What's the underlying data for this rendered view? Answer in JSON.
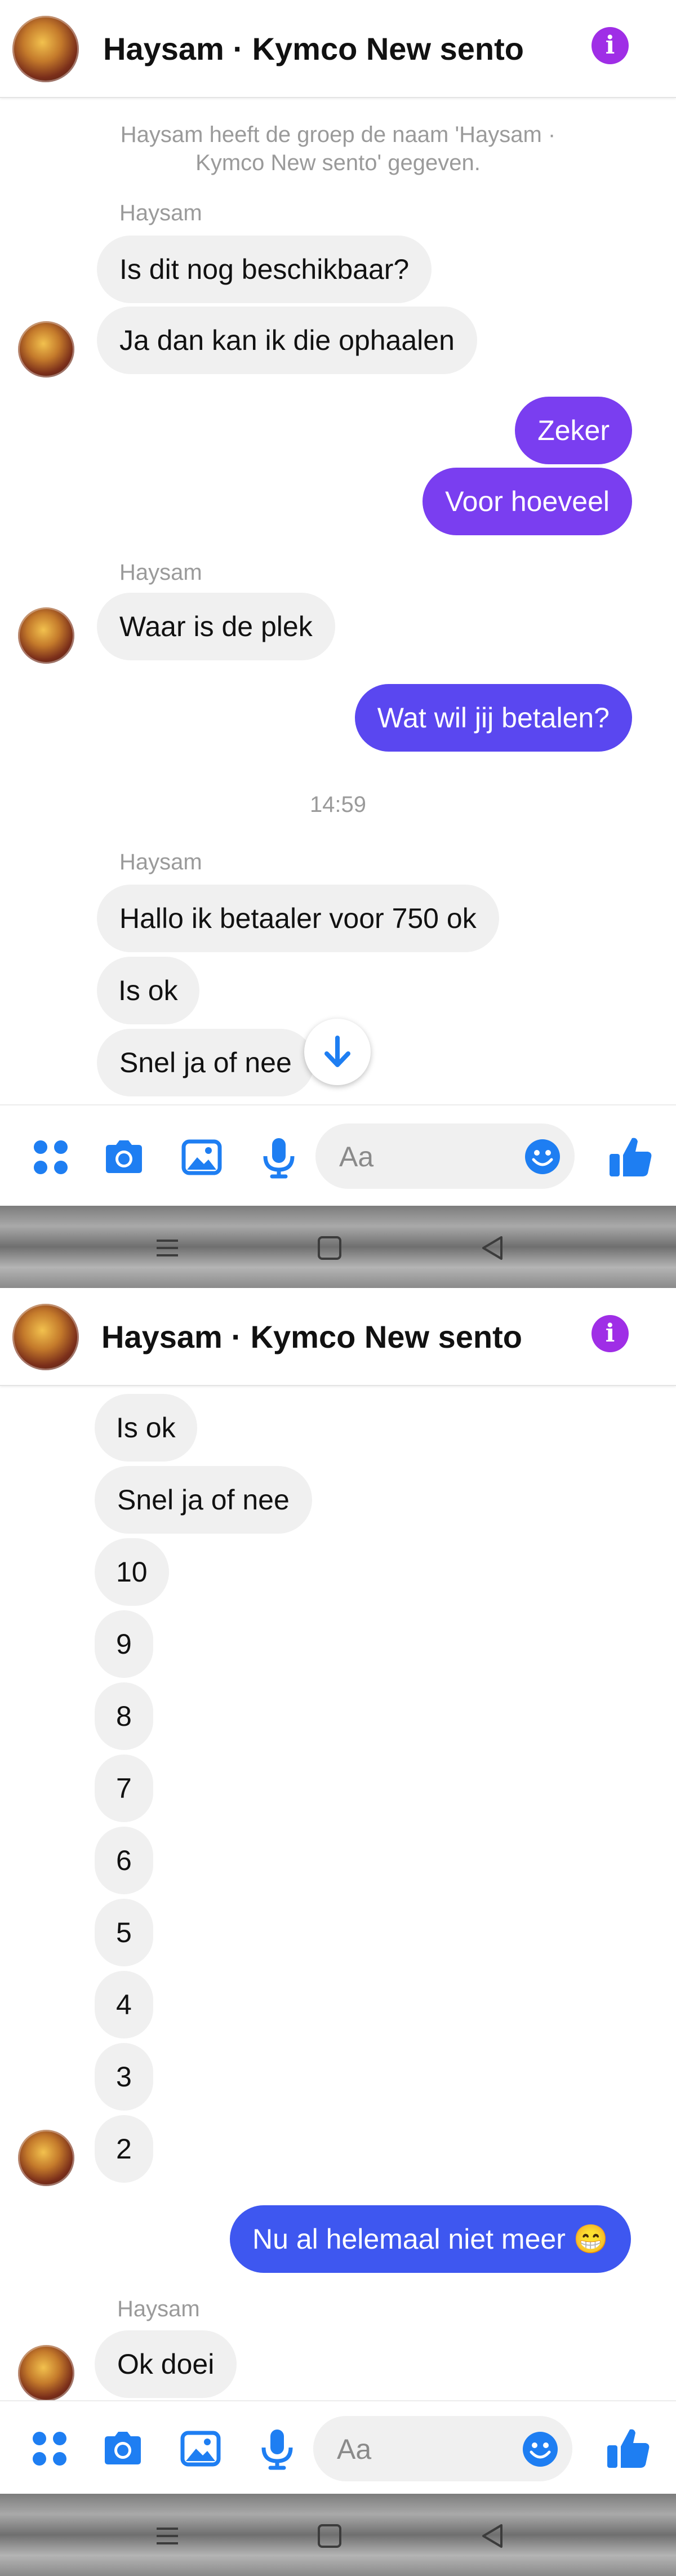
{
  "conversation": {
    "title": "Haysam · Kymco New sento",
    "system_notice": "Haysam heeft de groep de naam 'Haysam · Kymco New sento' gegeven.",
    "sender_name": "Haysam",
    "timestamp": "14:59"
  },
  "screen1": {
    "messages": [
      "Is dit nog beschikbaar?",
      "Ja dan kan ik die ophaalen",
      "Zeker",
      "Voor hoeveel",
      "Waar is de plek",
      "Wat wil jij betalen?",
      "Hallo ik betaaler voor 750 ok",
      "Is ok",
      "Snel ja of nee"
    ]
  },
  "screen2": {
    "messages": [
      "Is ok",
      "Snel ja of nee",
      "10",
      "9",
      "8",
      "7",
      "6",
      "5",
      "4",
      "3",
      "2",
      "Nu al helemaal niet meer 😁",
      "Ok doei"
    ]
  },
  "composer": {
    "placeholder": "Aa"
  },
  "toolbar": {
    "icons": [
      "menu-dots-icon",
      "camera-icon",
      "gallery-icon",
      "microphone-icon",
      "emoji-icon",
      "thumbs-up-icon"
    ]
  },
  "colors": {
    "accent": "#4e5cf0",
    "info": "#9f2ee6",
    "icon_blue": "#1e7ef2",
    "incoming_bubble": "#f0f0f0"
  }
}
